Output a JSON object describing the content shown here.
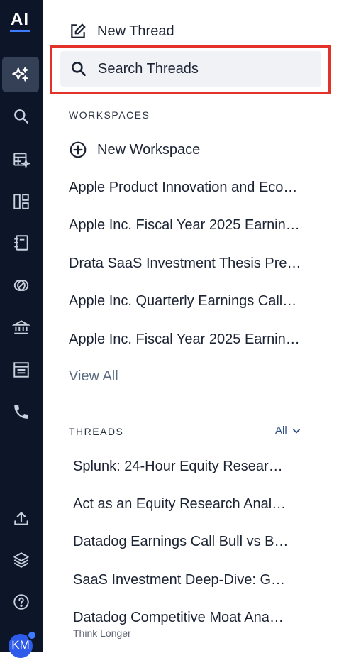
{
  "rail": {
    "logo": "AI",
    "icons": [
      {
        "name": "sparkle-icon",
        "active": true
      },
      {
        "name": "search-icon"
      },
      {
        "name": "table-sparkle-icon"
      },
      {
        "name": "dashboard-icon"
      },
      {
        "name": "notebook-icon"
      },
      {
        "name": "overlap-circles-icon"
      },
      {
        "name": "bank-icon"
      },
      {
        "name": "list-icon"
      },
      {
        "name": "phone-icon"
      },
      {
        "name": "upload-icon"
      },
      {
        "name": "layers-icon"
      },
      {
        "name": "help-icon"
      }
    ],
    "avatar": "KM"
  },
  "actions": {
    "new_thread": "New Thread",
    "search_threads": "Search Threads"
  },
  "workspaces": {
    "label": "WORKSPACES",
    "new_workspace": "New Workspace",
    "items": [
      "Apple Product Innovation and Eco…",
      "Apple Inc. Fiscal Year 2025 Earnin…",
      "Drata SaaS Investment Thesis Pre…",
      "Apple Inc. Quarterly Earnings Call…",
      "Apple Inc. Fiscal Year 2025 Earnin…"
    ],
    "view_all": "View All"
  },
  "threads": {
    "label": "THREADS",
    "filter": "All",
    "items": [
      "Splunk: 24-Hour Equity Researc…",
      "Act as an Equity Research Anal…",
      "Datadog Earnings Call Bull vs B…",
      "SaaS Investment Deep-Dive: Gr…",
      "Datadog Competitive Moat Ana…"
    ],
    "last_item_sub": "Think Longer"
  },
  "colors": {
    "rail_bg": "#0d1628",
    "accent": "#3d7bff",
    "highlight": "#e3322a"
  }
}
